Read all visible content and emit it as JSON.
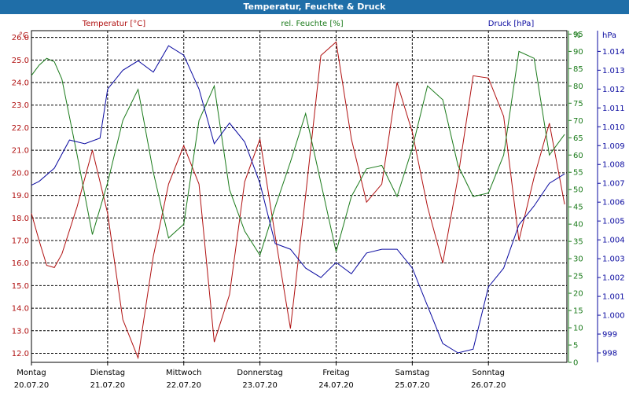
{
  "window": {
    "title": "Temperatur, Feuchte & Druck"
  },
  "colors": {
    "temperature": "#b01010",
    "humidity": "#1a7a1a",
    "pressure": "#0a0aa0",
    "grid": "#000000"
  },
  "chart_data": {
    "type": "line",
    "title": "Temperatur, Feuchte & Druck",
    "grid": true,
    "x_axis": {
      "days": [
        {
          "name": "Montag",
          "date": "20.07.20"
        },
        {
          "name": "Dienstag",
          "date": "21.07.20"
        },
        {
          "name": "Mittwoch",
          "date": "22.07.20"
        },
        {
          "name": "Donnerstag",
          "date": "23.07.20"
        },
        {
          "name": "Freitag",
          "date": "24.07.20"
        },
        {
          "name": "Samstag",
          "date": "25.07.20"
        },
        {
          "name": "Sonntag",
          "date": "26.07.20"
        }
      ],
      "range_days": [
        0,
        7.03
      ]
    },
    "axes": {
      "temperature": {
        "unit": "°C",
        "range": [
          11.6,
          26.3
        ],
        "ticks": [
          "12.0",
          "13.0",
          "14.0",
          "15.0",
          "16.0",
          "17.0",
          "18.0",
          "19.0",
          "20.0",
          "21.0",
          "22.0",
          "23.0",
          "24.0",
          "25.0",
          "26.0"
        ]
      },
      "humidity": {
        "unit": "%",
        "range": [
          0,
          96
        ],
        "ticks": [
          "0",
          "5",
          "10",
          "15",
          "20",
          "25",
          "30",
          "35",
          "40",
          "45",
          "50",
          "55",
          "60",
          "65",
          "70",
          "75",
          "80",
          "85",
          "90",
          "95"
        ]
      },
      "pressure": {
        "unit": "hPa",
        "range": [
          997.5,
          1015.1
        ],
        "ticks": [
          "998",
          "999",
          "1.000",
          "1.001",
          "1.002",
          "1.003",
          "1.004",
          "1.005",
          "1.006",
          "1.007",
          "1.008",
          "1.009",
          "1.010",
          "1.011",
          "1.012",
          "1.013",
          "1.014"
        ]
      }
    },
    "series": [
      {
        "name": "Temperatur [°C]",
        "axis": "temperature",
        "x": [
          0,
          0.1,
          0.2,
          0.3,
          0.4,
          0.6,
          0.8,
          1.0,
          1.2,
          1.4,
          1.6,
          1.8,
          2.0,
          2.2,
          2.4,
          2.6,
          2.8,
          3.0,
          3.2,
          3.4,
          3.6,
          3.8,
          4.0,
          4.2,
          4.4,
          4.6,
          4.8,
          5.0,
          5.2,
          5.4,
          5.6,
          5.8,
          6.0,
          6.2,
          6.4,
          6.6,
          6.8,
          7.0
        ],
        "y": [
          18.2,
          17.0,
          15.9,
          15.8,
          16.4,
          18.5,
          21.0,
          18.2,
          13.5,
          11.8,
          16.3,
          19.5,
          21.2,
          19.5,
          12.5,
          14.6,
          19.6,
          21.5,
          17.2,
          13.1,
          19.0,
          25.2,
          25.8,
          21.5,
          18.7,
          19.5,
          24.0,
          21.8,
          18.5,
          16.0,
          19.8,
          24.3,
          24.2,
          22.5,
          17.0,
          19.8,
          22.2,
          18.6
        ]
      },
      {
        "name": "rel. Feuchte [%]",
        "axis": "humidity",
        "x": [
          0,
          0.1,
          0.2,
          0.3,
          0.4,
          0.6,
          0.8,
          1.0,
          1.2,
          1.4,
          1.6,
          1.8,
          2.0,
          2.2,
          2.4,
          2.6,
          2.8,
          3.0,
          3.2,
          3.4,
          3.6,
          3.8,
          4.0,
          4.2,
          4.4,
          4.6,
          4.8,
          5.0,
          5.2,
          5.4,
          5.6,
          5.8,
          6.0,
          6.2,
          6.4,
          6.6,
          6.8,
          7.0
        ],
        "y": [
          83,
          86,
          88,
          87,
          82,
          60,
          37,
          52,
          70,
          79,
          55,
          36,
          40,
          70,
          80,
          50,
          38,
          31,
          45,
          58,
          72,
          52,
          32,
          48,
          56,
          57,
          48,
          62,
          80,
          76,
          57,
          48,
          49,
          60,
          90,
          88,
          60,
          66
        ]
      },
      {
        "name": "Druck [hPa]",
        "axis": "pressure",
        "x": [
          0,
          0.1,
          0.3,
          0.5,
          0.7,
          0.9,
          1.0,
          1.2,
          1.4,
          1.6,
          1.8,
          2.0,
          2.2,
          2.4,
          2.6,
          2.8,
          3.0,
          3.2,
          3.4,
          3.6,
          3.8,
          4.0,
          4.2,
          4.4,
          4.6,
          4.8,
          5.0,
          5.2,
          5.4,
          5.6,
          5.8,
          6.0,
          6.2,
          6.4,
          6.6,
          6.8,
          7.0
        ],
        "y": [
          1006.9,
          1007.1,
          1007.8,
          1009.3,
          1009.1,
          1009.4,
          1012.0,
          1013.0,
          1013.5,
          1012.9,
          1014.3,
          1013.8,
          1012.0,
          1009.1,
          1010.2,
          1009.2,
          1007.0,
          1003.8,
          1003.5,
          1002.5,
          1002.0,
          1002.8,
          1002.2,
          1003.3,
          1003.5,
          1003.5,
          1002.5,
          1000.5,
          998.5,
          998.0,
          998.2,
          1001.5,
          1002.5,
          1004.8,
          1005.8,
          1007.0,
          1007.5
        ]
      }
    ]
  }
}
